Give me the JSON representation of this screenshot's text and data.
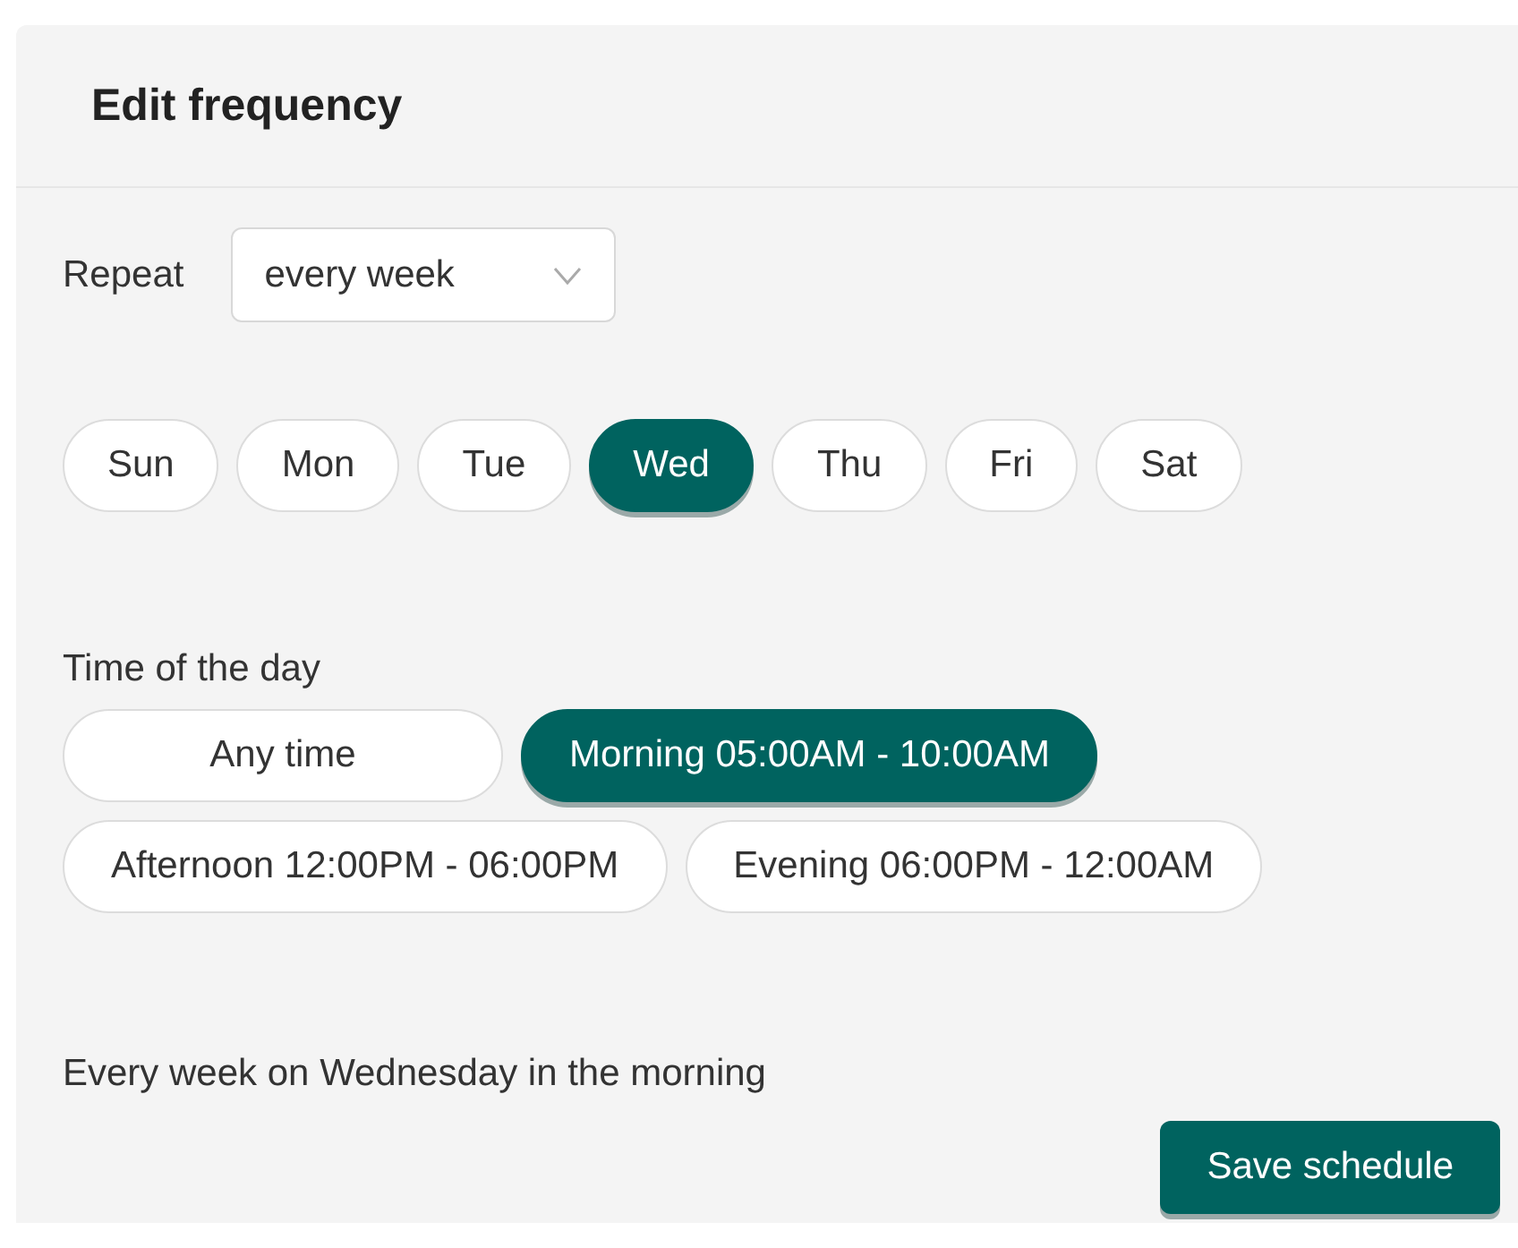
{
  "header": {
    "title": "Edit frequency"
  },
  "repeat": {
    "label": "Repeat",
    "value": "every week"
  },
  "days": [
    {
      "label": "Sun",
      "selected": false
    },
    {
      "label": "Mon",
      "selected": false
    },
    {
      "label": "Tue",
      "selected": false
    },
    {
      "label": "Wed",
      "selected": true
    },
    {
      "label": "Thu",
      "selected": false
    },
    {
      "label": "Fri",
      "selected": false
    },
    {
      "label": "Sat",
      "selected": false
    }
  ],
  "time_of_day": {
    "label": "Time of the day",
    "options": [
      {
        "label": "Any time",
        "selected": false
      },
      {
        "label": "Morning 05:00AM - 10:00AM",
        "selected": true
      },
      {
        "label": "Afternoon 12:00PM - 06:00PM",
        "selected": false
      },
      {
        "label": "Evening 06:00PM - 12:00AM",
        "selected": false
      }
    ]
  },
  "summary": "Every week on Wednesday in the morning",
  "save_button": "Save schedule"
}
